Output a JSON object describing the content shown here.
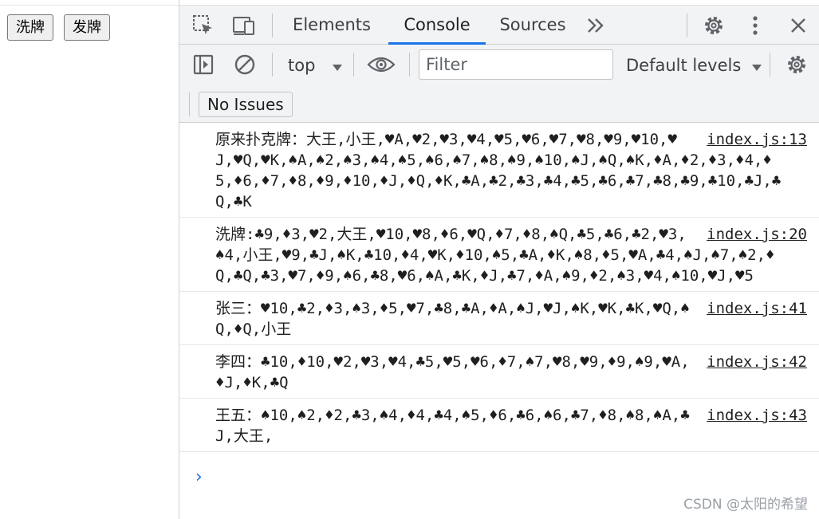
{
  "page": {
    "shuffle_button": "洗牌",
    "deal_button": "发牌"
  },
  "devtools": {
    "tabs": [
      "Elements",
      "Console",
      "Sources"
    ],
    "active_tab": "Console",
    "more_tabs_label": ">>",
    "context": "top",
    "filter_placeholder": "Filter",
    "levels_label": "Default levels",
    "issues_label": "No Issues"
  },
  "console": {
    "messages": [
      {
        "text": "原来扑克牌：大王,小王,♥A,♥2,♥3,♥4,♥5,♥6,♥7,♥8,♥9,♥10,♥J,♥Q,♥K,♠A,♠2,♠3,♠4,♠5,♠6,♠7,♠8,♠9,♠10,♠J,♠Q,♠K,♦A,♦2,♦3,♦4,♦5,♦6,♦7,♦8,♦9,♦10,♦J,♦Q,♦K,♣A,♣2,♣3,♣4,♣5,♣6,♣7,♣8,♣9,♣10,♣J,♣Q,♣K",
        "source": "index.js:13"
      },
      {
        "text": "洗牌:♣9,♦3,♥2,大王,♥10,♥8,♦6,♥Q,♦7,♦8,♠Q,♣5,♣6,♣2,♥3,♠4,小王,♥9,♣J,♠K,♣10,♦4,♥K,♦10,♠5,♣A,♦K,♠8,♦5,♥A,♣4,♠J,♠7,♠2,♦Q,♣Q,♣3,♥7,♦9,♠6,♣8,♥6,♠A,♣K,♦J,♣7,♦A,♠9,♦2,♠3,♥4,♠10,♥J,♥5",
        "source": "index.js:20"
      },
      {
        "text": "张三：♥10,♣2,♦3,♠3,♦5,♥7,♣8,♣A,♦A,♠J,♥J,♠K,♥K,♣K,♥Q,♠Q,♦Q,小王",
        "source": "index.js:41"
      },
      {
        "text": "李四：♣10,♦10,♥2,♥3,♥4,♣5,♥5,♥6,♦7,♠7,♥8,♥9,♦9,♠9,♥A,♦J,♦K,♣Q",
        "source": "index.js:42"
      },
      {
        "text": "王五：♠10,♠2,♦2,♣3,♠4,♦4,♣4,♠5,♦6,♣6,♠6,♣7,♦8,♠8,♠A,♣J,大王,",
        "source": "index.js:43"
      }
    ],
    "prompt_symbol": "›"
  },
  "watermark": "CSDN @太阳的希望",
  "colors": {
    "accent": "#1a73e8",
    "toolbar_bg": "#f1f3f4",
    "icon": "#5f6368"
  },
  "icons": [
    "inspect-icon",
    "device-toolbar-icon",
    "more-tabs-icon",
    "settings-icon",
    "kebab-menu-icon",
    "close-icon",
    "sidebar-toggle-icon",
    "clear-console-icon",
    "dropdown-arrow-icon",
    "eye-icon",
    "console-settings-icon",
    "prompt-chevron-icon"
  ]
}
